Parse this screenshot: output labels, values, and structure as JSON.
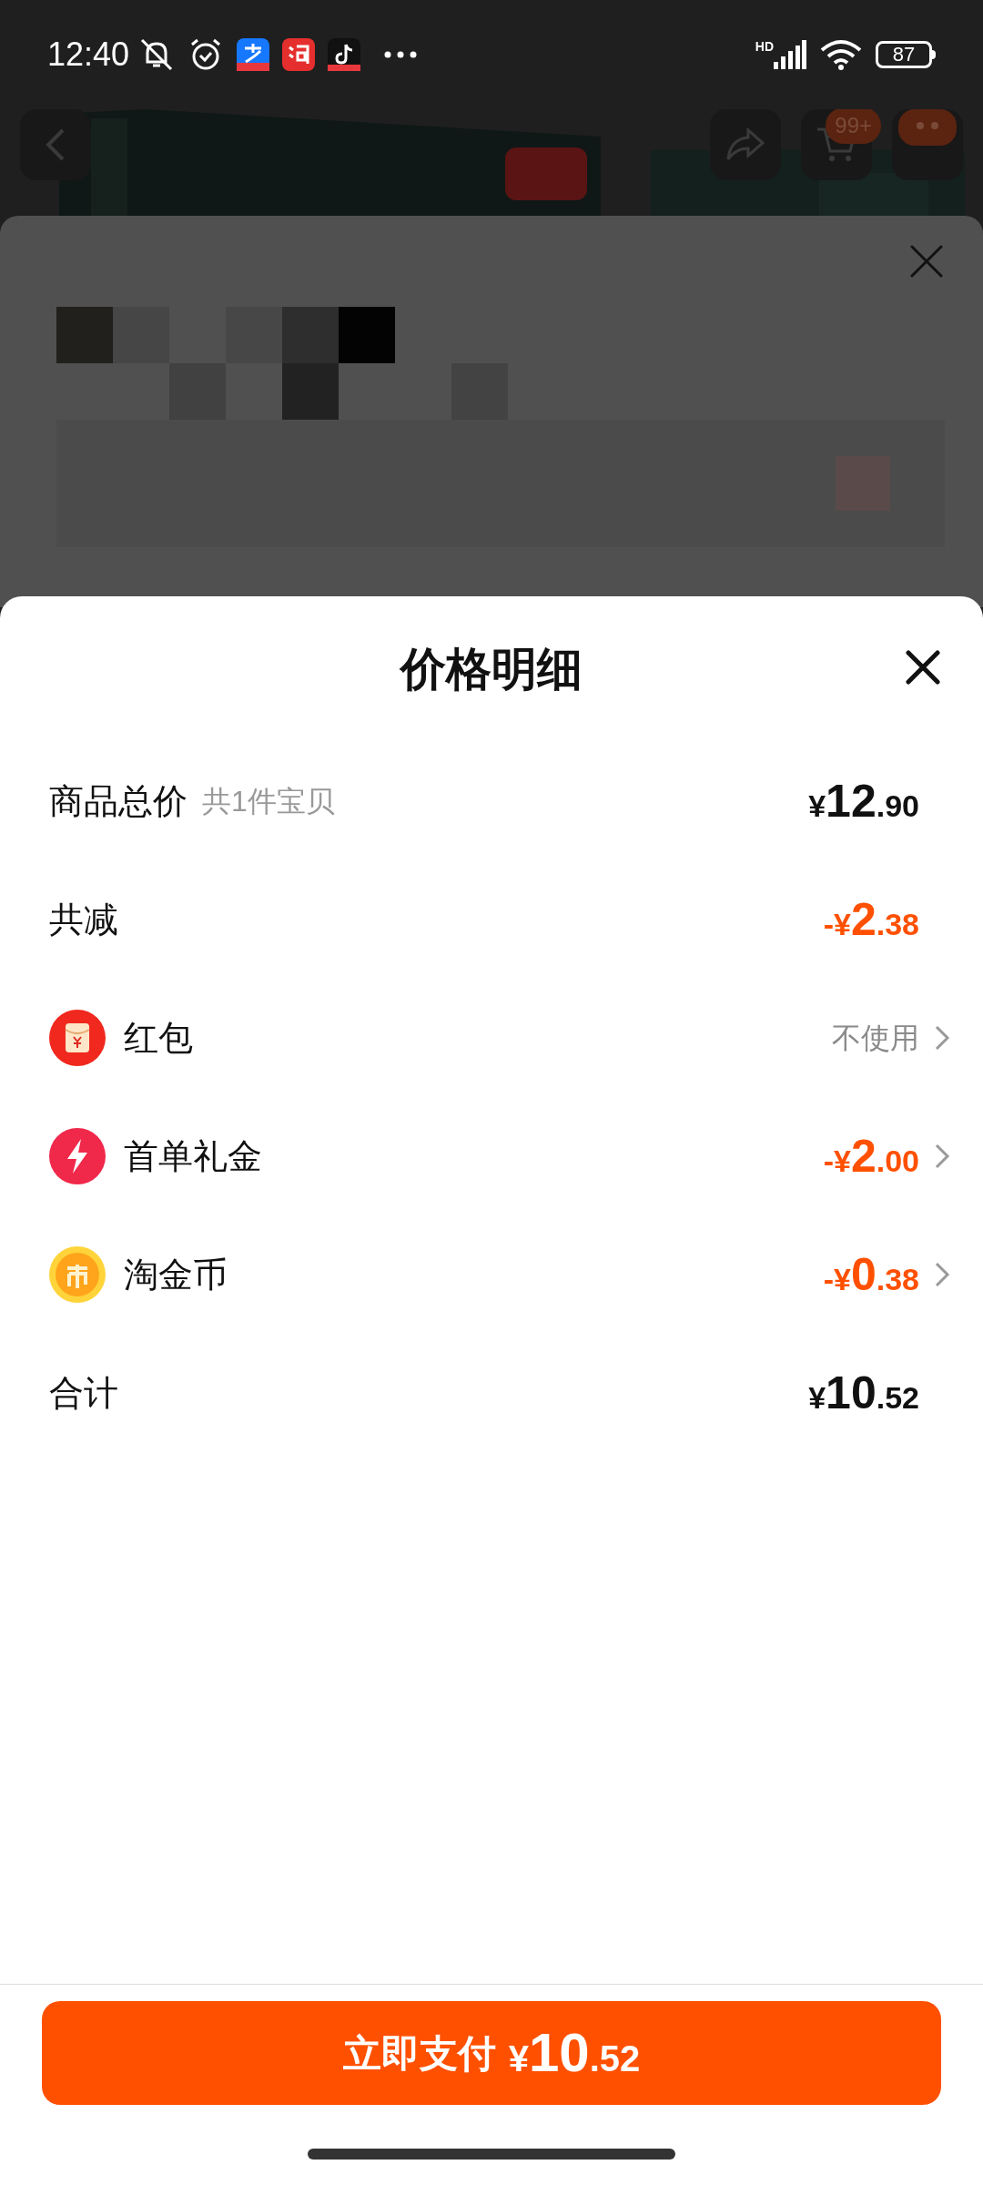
{
  "status_bar": {
    "time": "12:40",
    "network": "HD",
    "battery": "87"
  },
  "background_header": {
    "cart_badge": "99+"
  },
  "sheet": {
    "title": "价格明细",
    "rows": [
      {
        "kind": "plain",
        "label": "商品总价",
        "note": "共1件宝贝",
        "color": "#111111",
        "price": {
          "prefix": "¥",
          "whole": "12",
          "fraction": ".90"
        },
        "navigable": false
      },
      {
        "kind": "plain",
        "label": "共减",
        "color": "#ff5000",
        "price": {
          "prefix": "-¥",
          "whole": "2",
          "fraction": ".38"
        },
        "navigable": false
      },
      {
        "kind": "envelope",
        "label": "红包",
        "color": "#8a8a8a",
        "text": "不使用",
        "navigable": true
      },
      {
        "kind": "bolt",
        "label": "首单礼金",
        "color": "#ff5000",
        "price": {
          "prefix": "-¥",
          "whole": "2",
          "fraction": ".00"
        },
        "navigable": true
      },
      {
        "kind": "coin",
        "label": "淘金币",
        "color": "#ff5000",
        "price": {
          "prefix": "-¥",
          "whole": "0",
          "fraction": ".38"
        },
        "navigable": true
      },
      {
        "kind": "plain",
        "label": "合计",
        "color": "#111111",
        "price": {
          "prefix": "¥",
          "whole": "10",
          "fraction": ".52"
        },
        "navigable": false
      }
    ]
  },
  "pay_button": {
    "label": "立即支付",
    "price": {
      "prefix": "¥",
      "whole": "10",
      "fraction": ".52"
    }
  }
}
